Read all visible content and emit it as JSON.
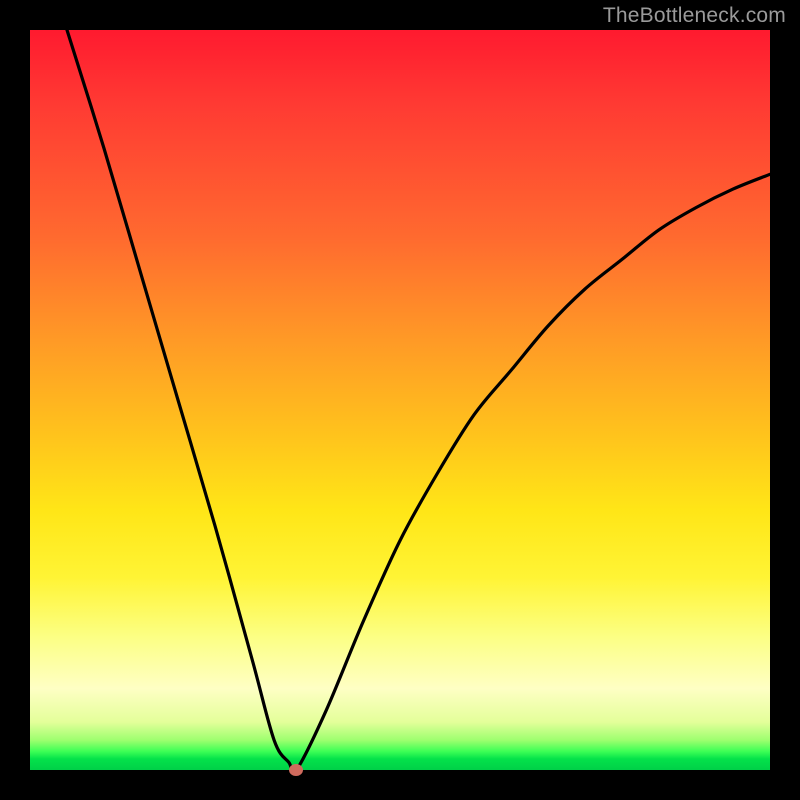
{
  "watermark": "TheBottleneck.com",
  "colors": {
    "frame": "#000000",
    "curve": "#000000",
    "dot": "#cf6a5d",
    "watermark_text": "#9a9a9a"
  },
  "chart_data": {
    "type": "line",
    "title": "",
    "xlabel": "",
    "ylabel": "",
    "xlim": [
      0,
      100
    ],
    "ylim": [
      0,
      100
    ],
    "grid": false,
    "legend": false,
    "series": [
      {
        "name": "bottleneck-curve",
        "x": [
          5,
          10,
          15,
          20,
          25,
          30,
          33,
          35,
          36,
          40,
          45,
          50,
          55,
          60,
          65,
          70,
          75,
          80,
          85,
          90,
          95,
          100
        ],
        "y": [
          100,
          84,
          67,
          50,
          33,
          15,
          4,
          1,
          0,
          8,
          20,
          31,
          40,
          48,
          54,
          60,
          65,
          69,
          73,
          76,
          78.5,
          80.5
        ]
      }
    ],
    "marker": {
      "x": 36,
      "y": 0,
      "color": "#cf6a5d"
    },
    "background_gradient": "vertical red→orange→yellow→green"
  }
}
